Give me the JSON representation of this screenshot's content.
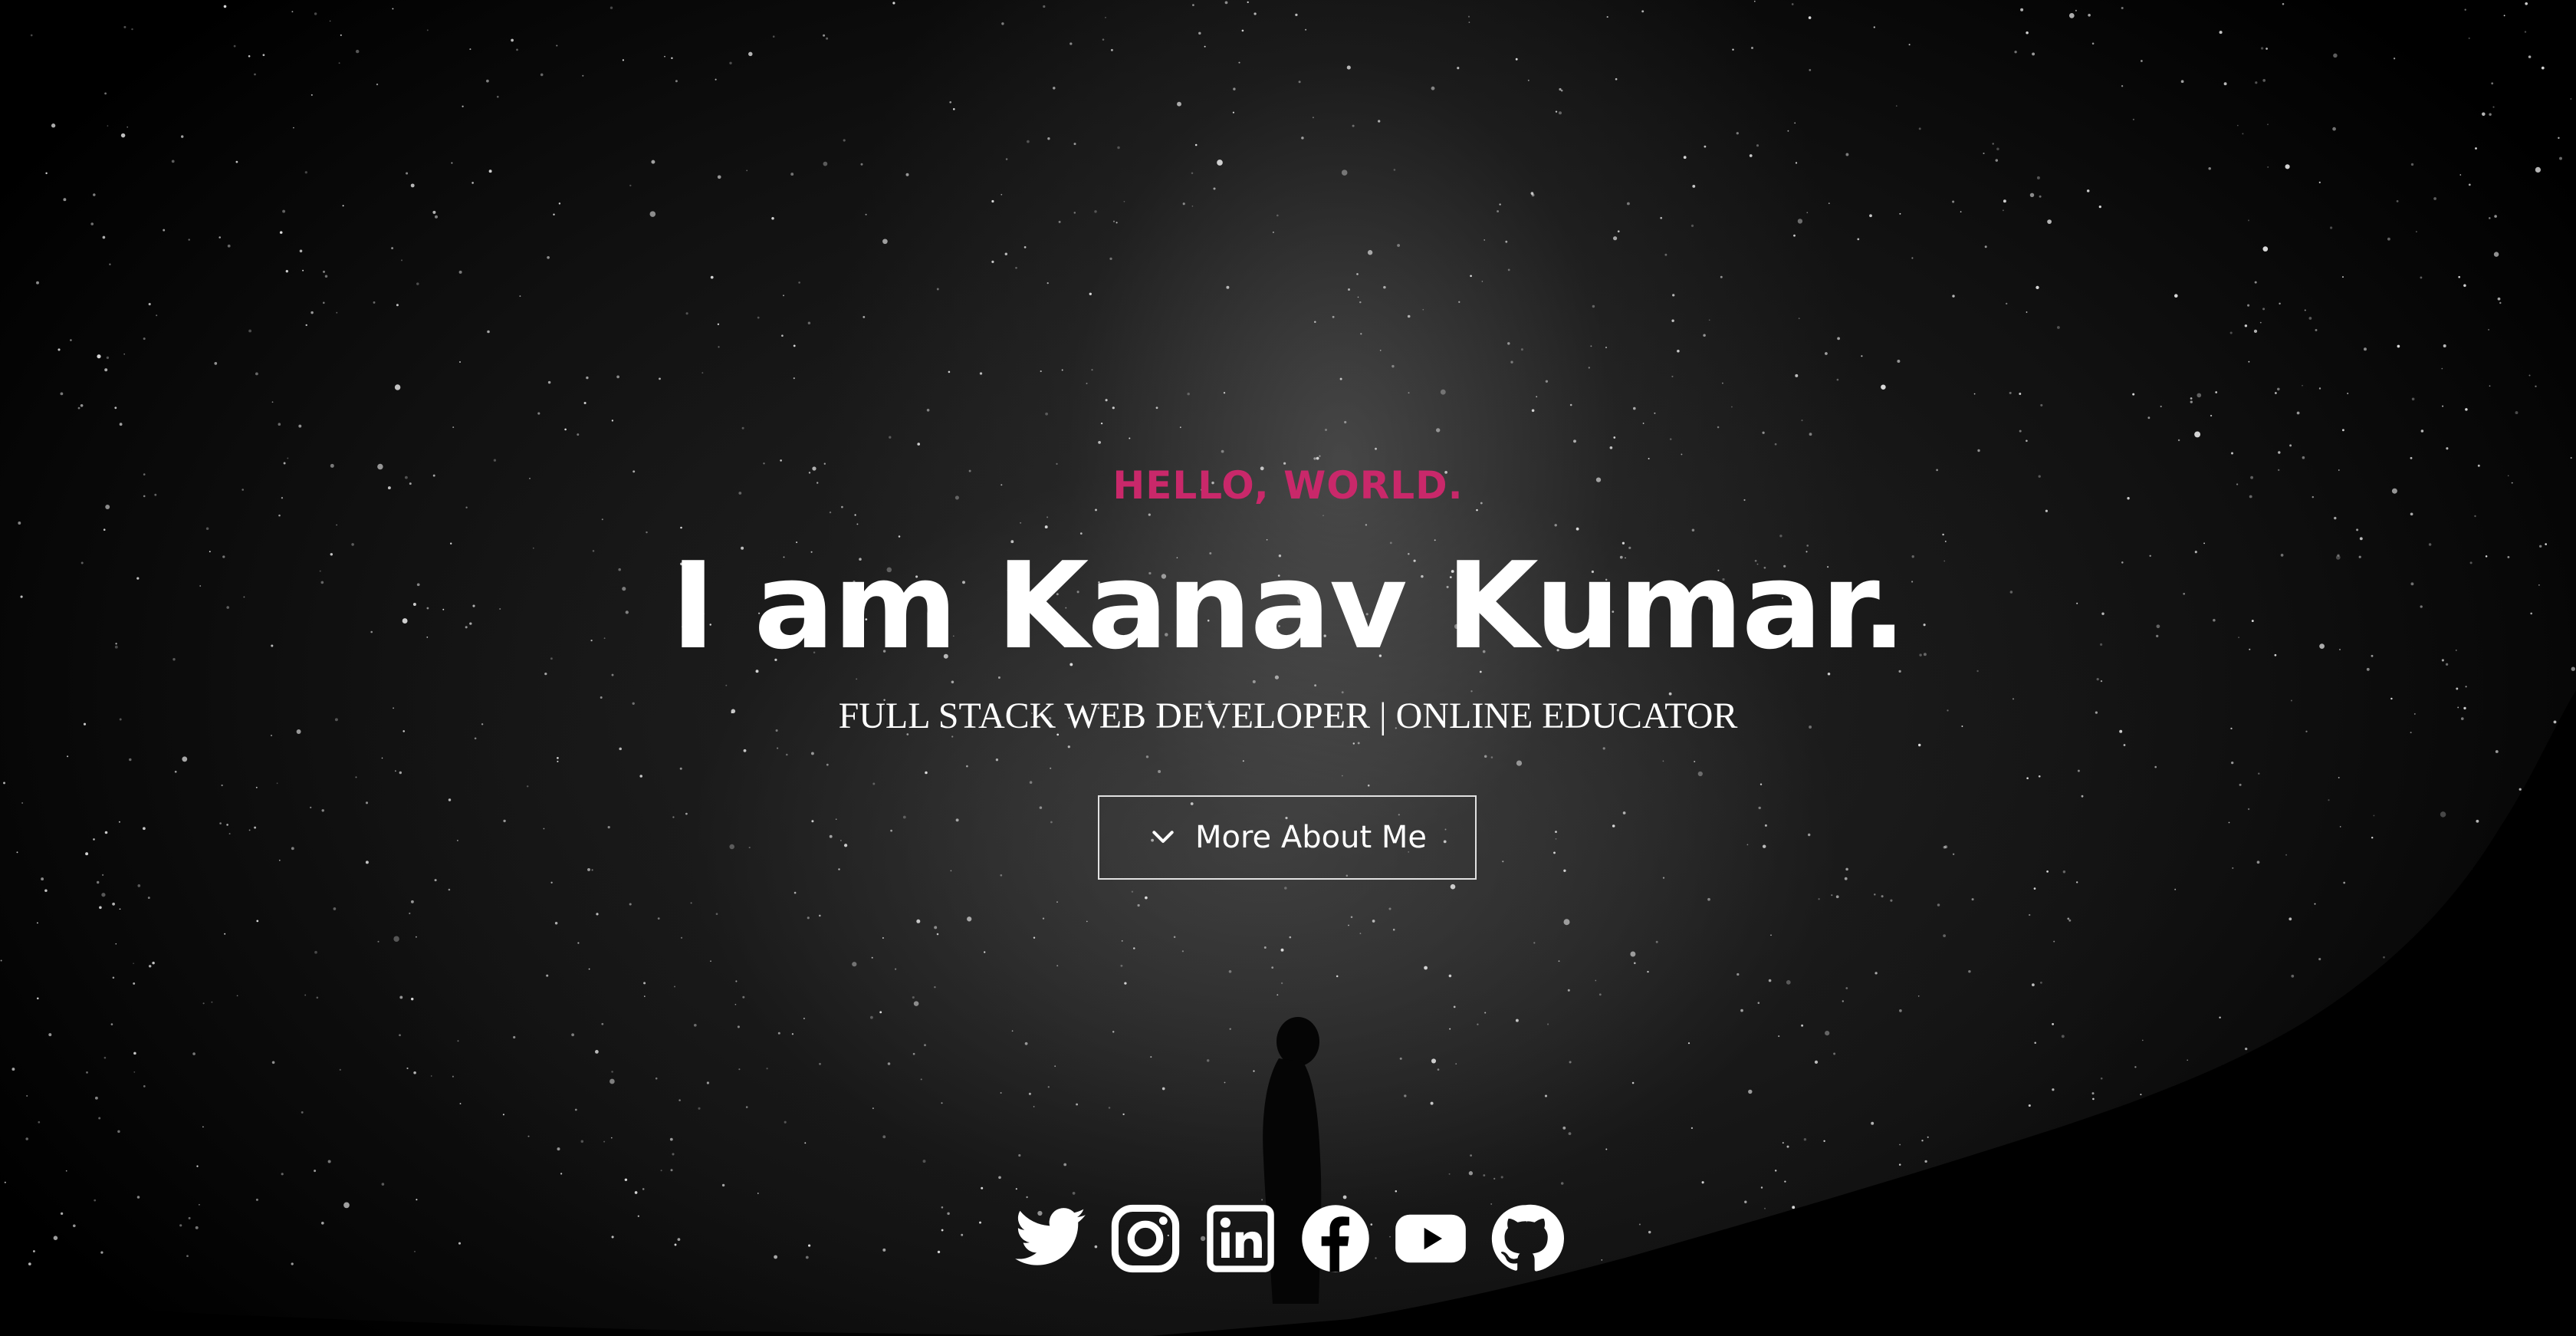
{
  "hero": {
    "greeting": "HELLO, WORLD.",
    "headline": "I am Kanav Kumar.",
    "subtitle": "FULL STACK WEB DEVELOPER | ONLINE EDUCATOR",
    "more_button_label": "More About Me"
  },
  "social_links": [
    {
      "icon": "twitter-icon"
    },
    {
      "icon": "instagram-icon"
    },
    {
      "icon": "linkedin-icon"
    },
    {
      "icon": "facebook-icon"
    },
    {
      "icon": "youtube-icon"
    },
    {
      "icon": "github-icon"
    }
  ],
  "colors": {
    "accent": "#c9286a",
    "text": "#ffffff",
    "background": "#000000"
  }
}
